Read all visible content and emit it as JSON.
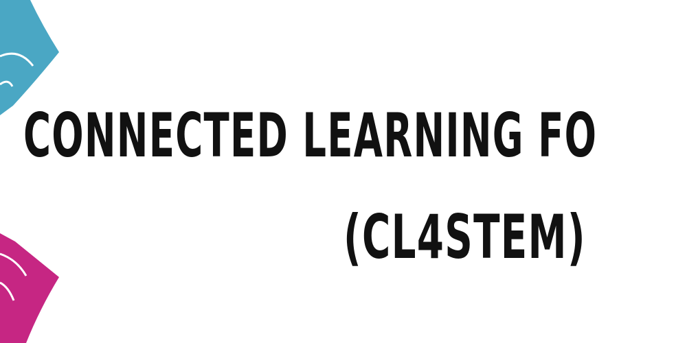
{
  "banner": {
    "title_line_1": "CONNECTED LEARNING FO",
    "title_line_2": "(CL4STEM)",
    "text_color": "#111111",
    "background_color": "#ffffff"
  },
  "logo": {
    "icon": "partial-circular-logo-icon",
    "top_color": "#4aa7c4",
    "bottom_color": "#c62683"
  }
}
